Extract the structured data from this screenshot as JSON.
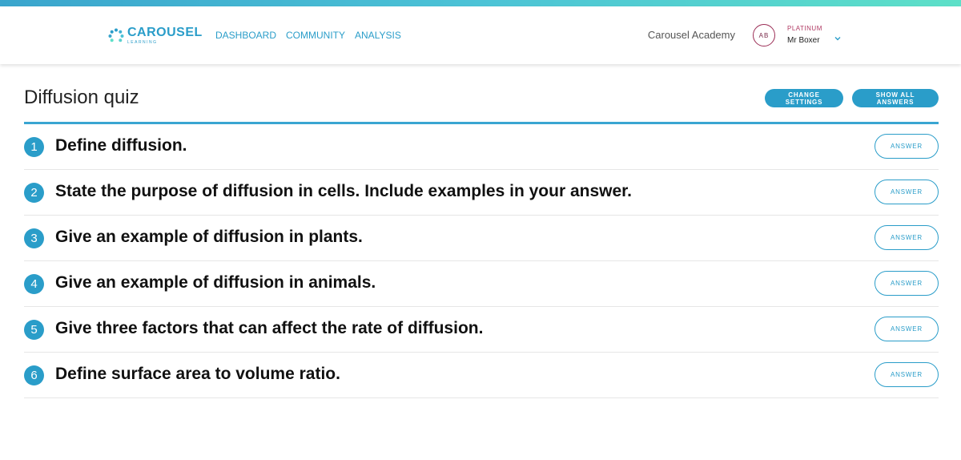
{
  "header": {
    "logo": {
      "title": "CAROUSEL",
      "subtitle": "LEARNING"
    },
    "nav": [
      {
        "label": "DASHBOARD"
      },
      {
        "label": "COMMUNITY"
      },
      {
        "label": "ANALYSIS"
      }
    ],
    "school": "Carousel Academy",
    "user": {
      "initials": "AB",
      "plan": "PLATINUM",
      "name": "Mr Boxer"
    }
  },
  "page": {
    "title": "Diffusion quiz",
    "change_settings_label": "CHANGE SETTINGS",
    "show_all_answers_label": "SHOW ALL ANSWERS"
  },
  "questions": [
    {
      "number": "1",
      "text": "Define diffusion.",
      "answer_label": "ANSWER"
    },
    {
      "number": "2",
      "text": "State the purpose of diffusion in cells. Include examples in your answer.",
      "answer_label": "ANSWER"
    },
    {
      "number": "3",
      "text": "Give an example of diffusion in plants.",
      "answer_label": "ANSWER"
    },
    {
      "number": "4",
      "text": "Give an example of diffusion in animals.",
      "answer_label": "ANSWER"
    },
    {
      "number": "5",
      "text": "Give three factors that can affect the rate of diffusion.",
      "answer_label": "ANSWER"
    },
    {
      "number": "6",
      "text": "Define surface area to volume ratio.",
      "answer_label": "ANSWER"
    }
  ],
  "colors": {
    "accent": "#2a9dc9",
    "plan": "#b03a63",
    "rule": "#3aa5d2"
  },
  "icons": {
    "logo": "carousel-dots-icon",
    "user_menu": "chevron-down-icon"
  }
}
